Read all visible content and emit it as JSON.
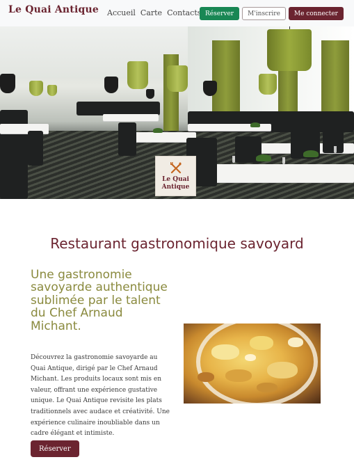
{
  "navbar": {
    "brand": "Le Quai Antique",
    "links": [
      "Accueil",
      "Carte",
      "Contacts"
    ],
    "buttons": {
      "reserve": "Réserver",
      "signup": "M'inscrire",
      "login": "Me connecter"
    }
  },
  "hero": {
    "logo_line1": "Le Quai",
    "logo_line2": "Antique",
    "logo_icon": "crossed-fork-knife-icon"
  },
  "content": {
    "title": "Restaurant gastronomique savoyard",
    "subtitle": "Une gastronomie savoyarde authentique sublimée par le talent du Chef Arnaud Michant.",
    "description": "Découvrez la gastronomie savoyarde au Quai Antique, dirigé par le Chef Arnaud Michant. Les produits locaux sont mis en valeur, offrant une expérience gustative unique. Le Quai Antique revisite les plats traditionnels avec audace et créativité. Une expérience culinaire inoubliable dans un cadre élégant et intimiste.",
    "cta": "Réserver"
  },
  "colors": {
    "brand": "#6b2430",
    "olive": "#8a8a3e",
    "green_button": "#198754"
  }
}
